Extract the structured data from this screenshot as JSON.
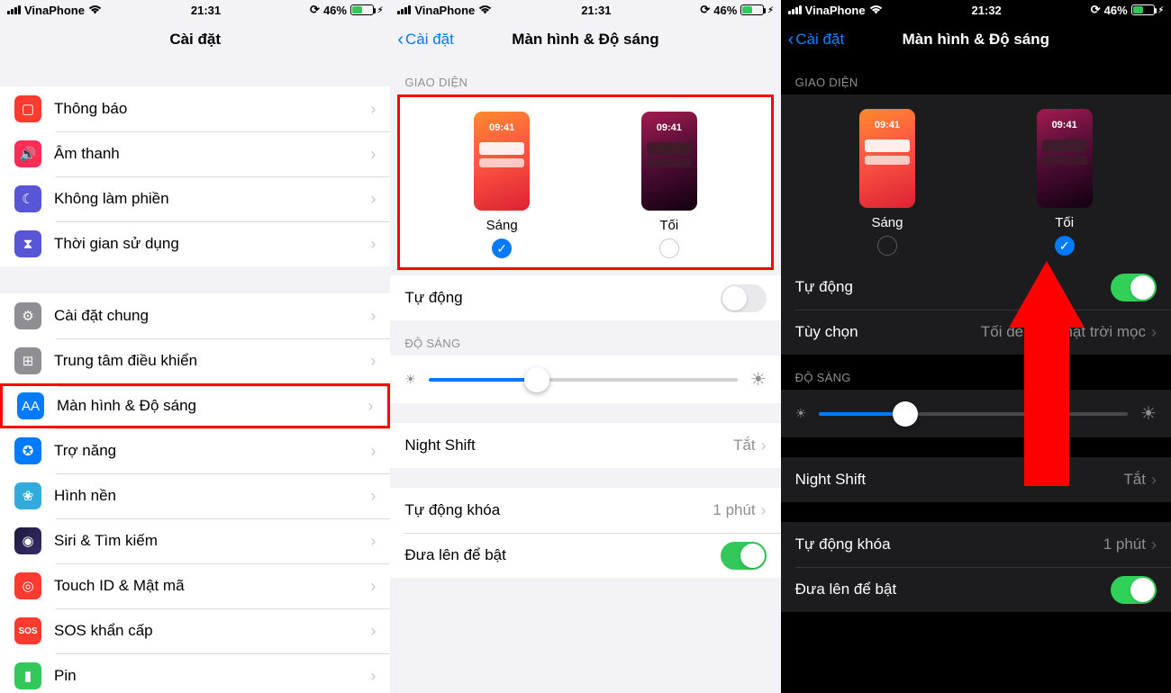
{
  "status": {
    "carrier": "VinaPhone",
    "time1": "21:31",
    "time2": "21:31",
    "time3": "21:32",
    "battery_pct": "46%"
  },
  "screen1": {
    "title": "Cài đặt",
    "items": {
      "notif": "Thông báo",
      "sound": "Âm thanh",
      "dnd": "Không làm phiền",
      "screentime": "Thời gian sử dụng",
      "general": "Cài đặt chung",
      "control": "Trung tâm điều khiển",
      "display": "Màn hình & Độ sáng",
      "access": "Trợ năng",
      "wallpaper": "Hình nền",
      "siri": "Siri & Tìm kiếm",
      "touchid": "Touch ID & Mật mã",
      "sos": "SOS khẩn cấp",
      "battery": "Pin"
    }
  },
  "display": {
    "back": "Cài đặt",
    "title": "Màn hình & Độ sáng",
    "sec_appearance": "GIAO DIỆN",
    "light": "Sáng",
    "dark_label": "Tối",
    "preview_clock": "09:41",
    "auto": "Tự động",
    "options": "Tùy chọn",
    "options_value": "Tối đến khi mặt trời mọc",
    "sec_brightness": "ĐỘ SÁNG",
    "nightshift": "Night Shift",
    "nightshift_value": "Tắt",
    "autolock": "Tự động khóa",
    "autolock_value": "1 phút",
    "raise": "Đưa lên để bật"
  },
  "screen2_slider_pct": 35,
  "screen3_slider_pct": 28
}
